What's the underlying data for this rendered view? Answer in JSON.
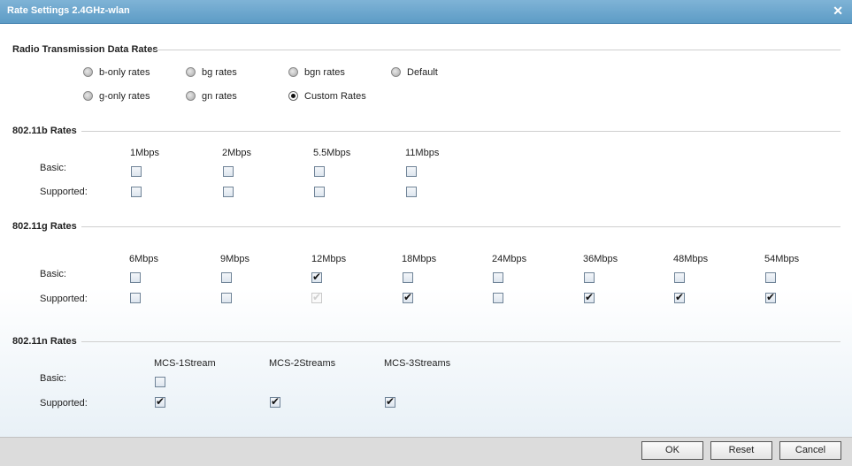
{
  "window": {
    "title": "Rate Settings 2.4GHz-wlan",
    "close_glyph": "✕"
  },
  "radio_section": {
    "heading": "Radio Transmission Data Rates",
    "options": [
      {
        "label": "b-only rates",
        "selected": false
      },
      {
        "label": "bg rates",
        "selected": false
      },
      {
        "label": "bgn rates",
        "selected": false
      },
      {
        "label": "Default",
        "selected": false
      },
      {
        "label": "g-only rates",
        "selected": false
      },
      {
        "label": "gn rates",
        "selected": false
      },
      {
        "label": "Custom Rates",
        "selected": true
      }
    ]
  },
  "b_rates": {
    "heading": "802.11b Rates",
    "row_basic": "Basic:",
    "row_supported": "Supported:",
    "columns": [
      "1Mbps",
      "2Mbps",
      "5.5Mbps",
      "11Mbps"
    ],
    "basic": [
      false,
      false,
      false,
      false
    ],
    "supported": [
      false,
      false,
      false,
      false
    ]
  },
  "g_rates": {
    "heading": "802.11g Rates",
    "row_basic": "Basic:",
    "row_supported": "Supported:",
    "columns": [
      "6Mbps",
      "9Mbps",
      "12Mbps",
      "18Mbps",
      "24Mbps",
      "36Mbps",
      "48Mbps",
      "54Mbps"
    ],
    "basic": [
      false,
      false,
      true,
      false,
      false,
      false,
      false,
      false
    ],
    "supported": [
      false,
      false,
      "disabled-checked",
      true,
      false,
      true,
      true,
      true
    ]
  },
  "n_rates": {
    "heading": "802.11n Rates",
    "row_basic": "Basic:",
    "row_supported": "Supported:",
    "columns": [
      "MCS-1Stream",
      "MCS-2Streams",
      "MCS-3Streams"
    ],
    "basic": [
      false
    ],
    "supported": [
      true,
      true,
      true
    ]
  },
  "footer": {
    "ok_label": "OK",
    "reset_label": "Reset",
    "cancel_label": "Cancel"
  }
}
